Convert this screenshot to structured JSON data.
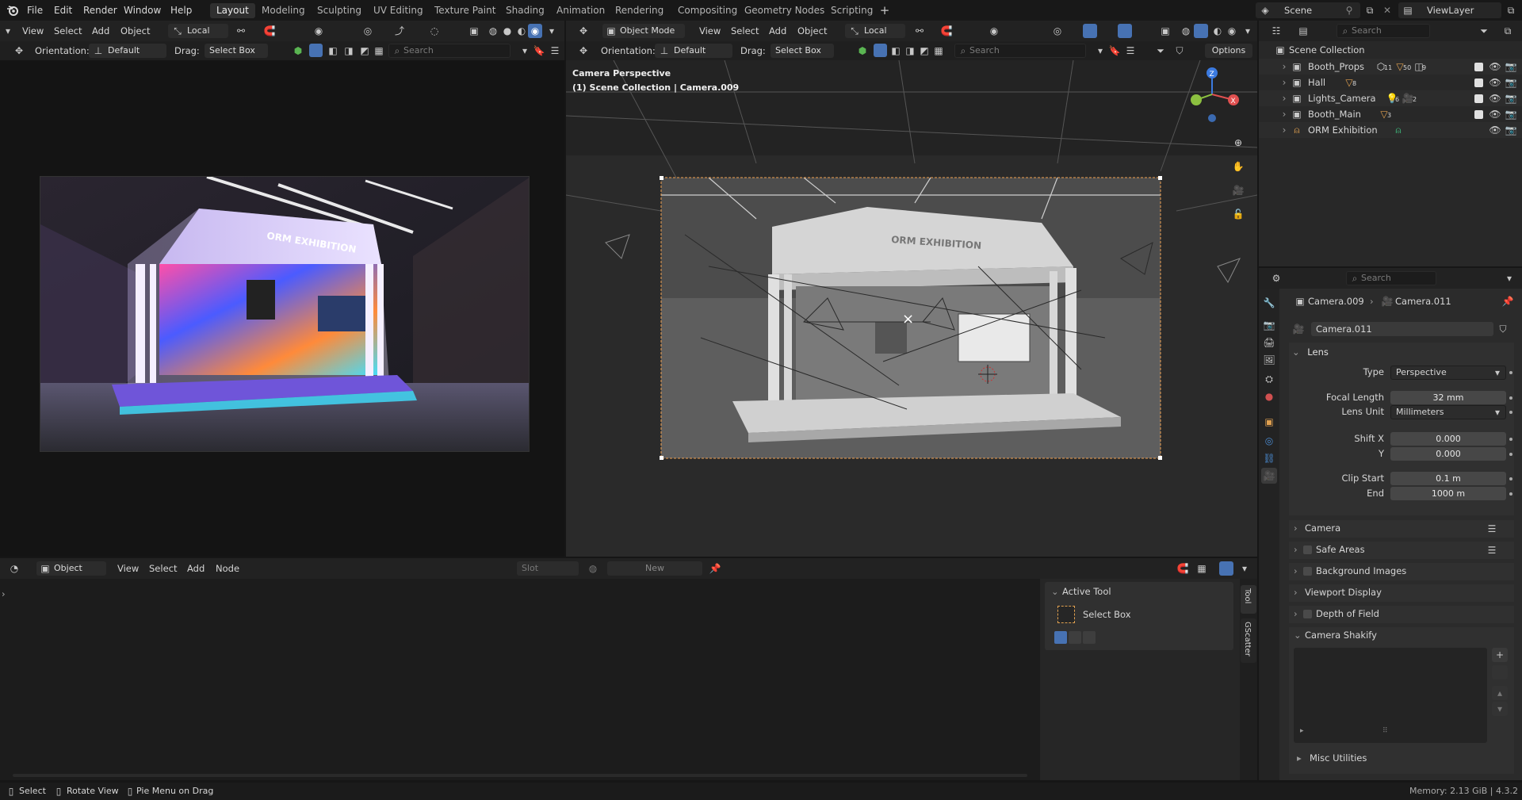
{
  "menubar": {
    "items": [
      "File",
      "Edit",
      "Render",
      "Window",
      "Help"
    ],
    "workspaces": [
      "Layout",
      "Modeling",
      "Sculpting",
      "UV Editing",
      "Texture Paint",
      "Shading",
      "Animation",
      "Rendering",
      "Compositing",
      "Geometry Nodes",
      "Scripting"
    ],
    "active_workspace": "Layout",
    "scene": "Scene",
    "view_layer": "ViewLayer"
  },
  "left_view": {
    "menus": [
      "View",
      "Select",
      "Add",
      "Object"
    ],
    "transform": "Local",
    "orientation_label": "Orientation:",
    "orientation_value": "Default",
    "drag_label": "Drag:",
    "drag_value": "Select Box",
    "search_placeholder": "Search"
  },
  "right_view": {
    "mode": "Object Mode",
    "menus": [
      "View",
      "Select",
      "Add",
      "Object"
    ],
    "transform": "Local",
    "orientation_label": "Orientation:",
    "orientation_value": "Default",
    "drag_label": "Drag:",
    "drag_value": "Select Box",
    "search_placeholder": "Search",
    "options_label": "Options",
    "overlay_line1": "Camera Perspective",
    "overlay_line2": "(1) Scene Collection | Camera.009",
    "booth_sign": "ORM EXHIBITION"
  },
  "render": {
    "sign": "ORM EXHIBITION"
  },
  "outliner": {
    "search_placeholder": "Search",
    "root": "Scene Collection",
    "items": [
      {
        "name": "Booth_Props",
        "badge1": "11",
        "badge2": "50",
        "badge3": "9"
      },
      {
        "name": "Hall",
        "badge1": "8"
      },
      {
        "name": "Lights_Camera",
        "badge1": "6",
        "badge2": "2"
      },
      {
        "name": "Booth_Main",
        "badge1": "3"
      },
      {
        "name": "ORM Exhibition"
      }
    ]
  },
  "properties": {
    "search_placeholder": "Search",
    "breadcrumb_object": "Camera.009",
    "breadcrumb_data": "Camera.011",
    "data_name": "Camera.011",
    "lens_title": "Lens",
    "type_label": "Type",
    "type_value": "Perspective",
    "focal_label": "Focal Length",
    "focal_value": "32 mm",
    "lens_unit_label": "Lens Unit",
    "lens_unit_value": "Millimeters",
    "shift_x_label": "Shift X",
    "shift_x_value": "0.000",
    "shift_y_label": "Y",
    "shift_y_value": "0.000",
    "clip_start_label": "Clip Start",
    "clip_start_value": "0.1 m",
    "clip_end_label": "End",
    "clip_end_value": "1000 m",
    "panels": [
      "Camera",
      "Safe Areas",
      "Background Images",
      "Viewport Display",
      "Depth of Field",
      "Camera Shakify"
    ],
    "misc": "Misc Utilities"
  },
  "node_editor": {
    "editor_type": "Object",
    "menus": [
      "View",
      "Select",
      "Add",
      "Node"
    ],
    "slot_label": "Slot",
    "new_label": "New"
  },
  "tool_panel": {
    "title": "Active Tool",
    "tool_name": "Select Box",
    "tabs": [
      "Tool",
      "GScatter"
    ]
  },
  "statusbar": {
    "select": "Select",
    "rotate": "Rotate View",
    "pie": "Pie Menu on Drag",
    "memory": "Memory: 2.13 GiB | 4.3.2"
  },
  "colors": {
    "accent": "#4772b3",
    "active_border": "#f0a050",
    "background": "#161616",
    "panel": "#303030"
  }
}
